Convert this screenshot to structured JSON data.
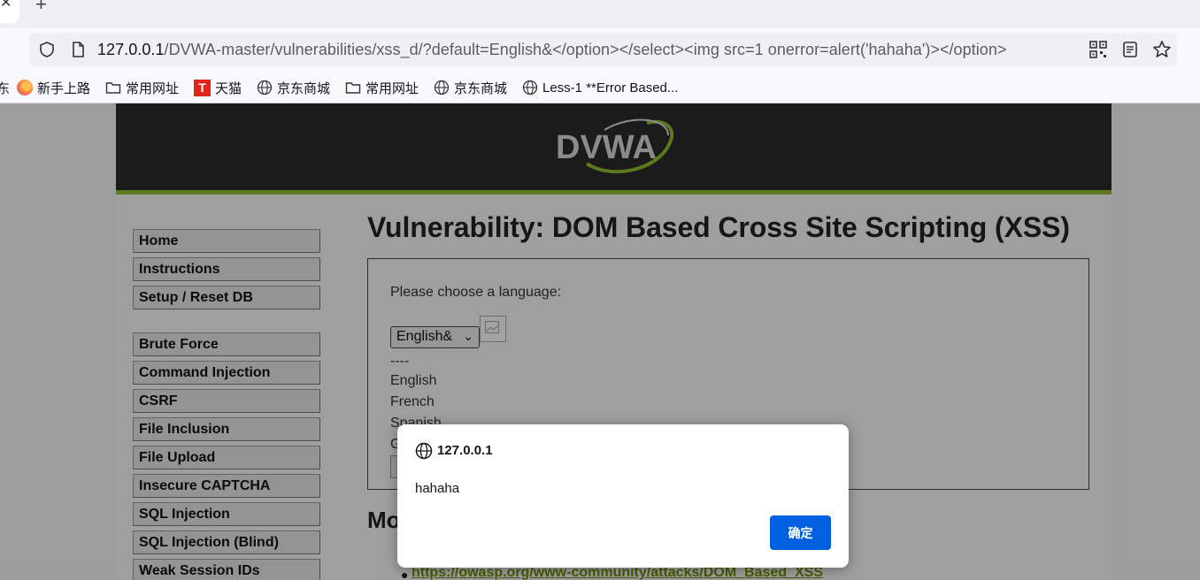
{
  "browser": {
    "url_host": "127.0.0.1",
    "url_path": "/DVWA-master/vulnerabilities/xss_d/?default=English&</option></select><img src=1 onerror=alert('hahaha')></option>",
    "bookmark_cut": "东",
    "bookmarks": [
      {
        "label": "新手上路",
        "icon": "firefox-icon"
      },
      {
        "label": "常用网址",
        "icon": "folder-icon"
      },
      {
        "label": "天猫",
        "icon": "tmall-icon",
        "icon_text": "T"
      },
      {
        "label": "京东商城",
        "icon": "globe-icon"
      },
      {
        "label": "常用网址",
        "icon": "folder-icon"
      },
      {
        "label": "京东商城",
        "icon": "globe-icon"
      },
      {
        "label": "Less-1 **Error Based...",
        "icon": "globe-icon"
      }
    ]
  },
  "dvwa": {
    "logo_text": "DVWA",
    "menu_group1": [
      "Home",
      "Instructions",
      "Setup / Reset DB"
    ],
    "menu_group2": [
      "Brute Force",
      "Command Injection",
      "CSRF",
      "File Inclusion",
      "File Upload",
      "Insecure CAPTCHA",
      "SQL Injection",
      "SQL Injection (Blind)",
      "Weak Session IDs"
    ],
    "title": "Vulnerability: DOM Based Cross Site Scripting (XSS)",
    "choose_label": "Please choose a language:",
    "select_value": "English&",
    "options": [
      "----",
      "English",
      "French",
      "Spanish",
      "G"
    ],
    "more_heading": "Mo",
    "more_link": "https://owasp.org/www-community/attacks/DOM_Based_XSS"
  },
  "dialog": {
    "origin": "127.0.0.1",
    "message": "hahaha",
    "ok_label": "确定"
  },
  "colors": {
    "dvwa_green": "#8dbb2f",
    "header_dark": "#2a2a2a",
    "dialog_button": "#0061e0"
  }
}
